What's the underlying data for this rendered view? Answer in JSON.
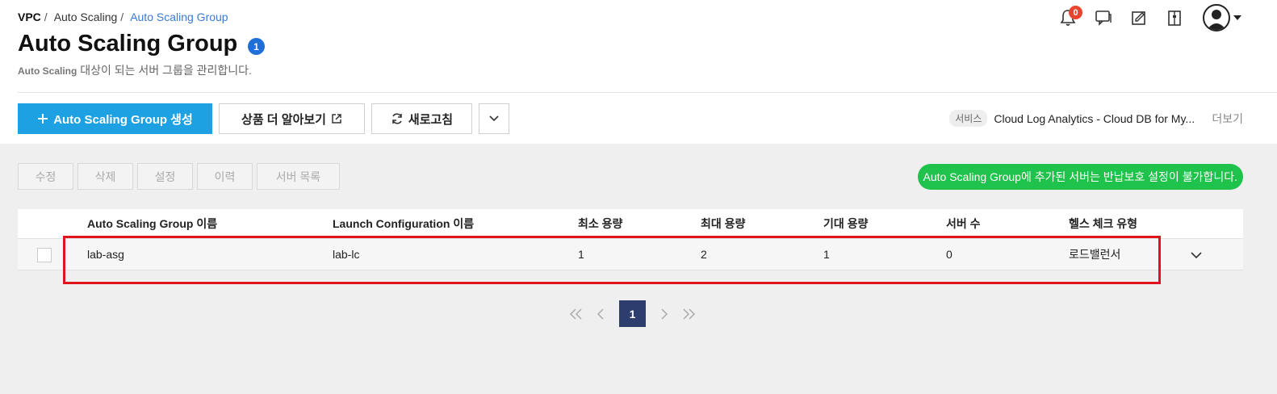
{
  "breadcrumb": {
    "root": "VPC",
    "sep": "/",
    "parent": "Auto Scaling",
    "current": "Auto Scaling Group"
  },
  "header": {
    "title": "Auto Scaling Group",
    "count": "1",
    "subtitle_strong": "Auto Scaling",
    "subtitle_rest": " 대상이 되는 서버 그룹을 관리합니다."
  },
  "notifications": {
    "count": "0"
  },
  "toolbar": {
    "create_label": "Auto Scaling Group 생성",
    "learn_label": "상품 더 알아보기",
    "refresh_label": "새로고침"
  },
  "service": {
    "tag": "서비스",
    "list": "Cloud Log Analytics - Cloud DB for My...",
    "more": "더보기"
  },
  "actions": {
    "edit": "수정",
    "delete": "삭제",
    "settings": "설정",
    "history": "이력",
    "server_list": "서버 목록"
  },
  "notice": "Auto Scaling Group에 추가된 서버는 반납보호 설정이 불가합니다.",
  "table": {
    "columns": [
      "Auto Scaling Group 이름",
      "Launch Configuration 이름",
      "최소 용량",
      "최대 용량",
      "기대 용량",
      "서버 수",
      "헬스 체크 유형"
    ],
    "rows": [
      {
        "name": "lab-asg",
        "launch_config": "lab-lc",
        "min": "1",
        "max": "2",
        "desired": "1",
        "servers": "0",
        "health_check": "로드밸런서"
      }
    ]
  },
  "pagination": {
    "current": "1"
  },
  "colors": {
    "primary": "#1da1e2",
    "notice": "#1fc24a",
    "badge": "#1f6fd6",
    "page_active": "#2d3d6e",
    "highlight": "#e0141c"
  }
}
